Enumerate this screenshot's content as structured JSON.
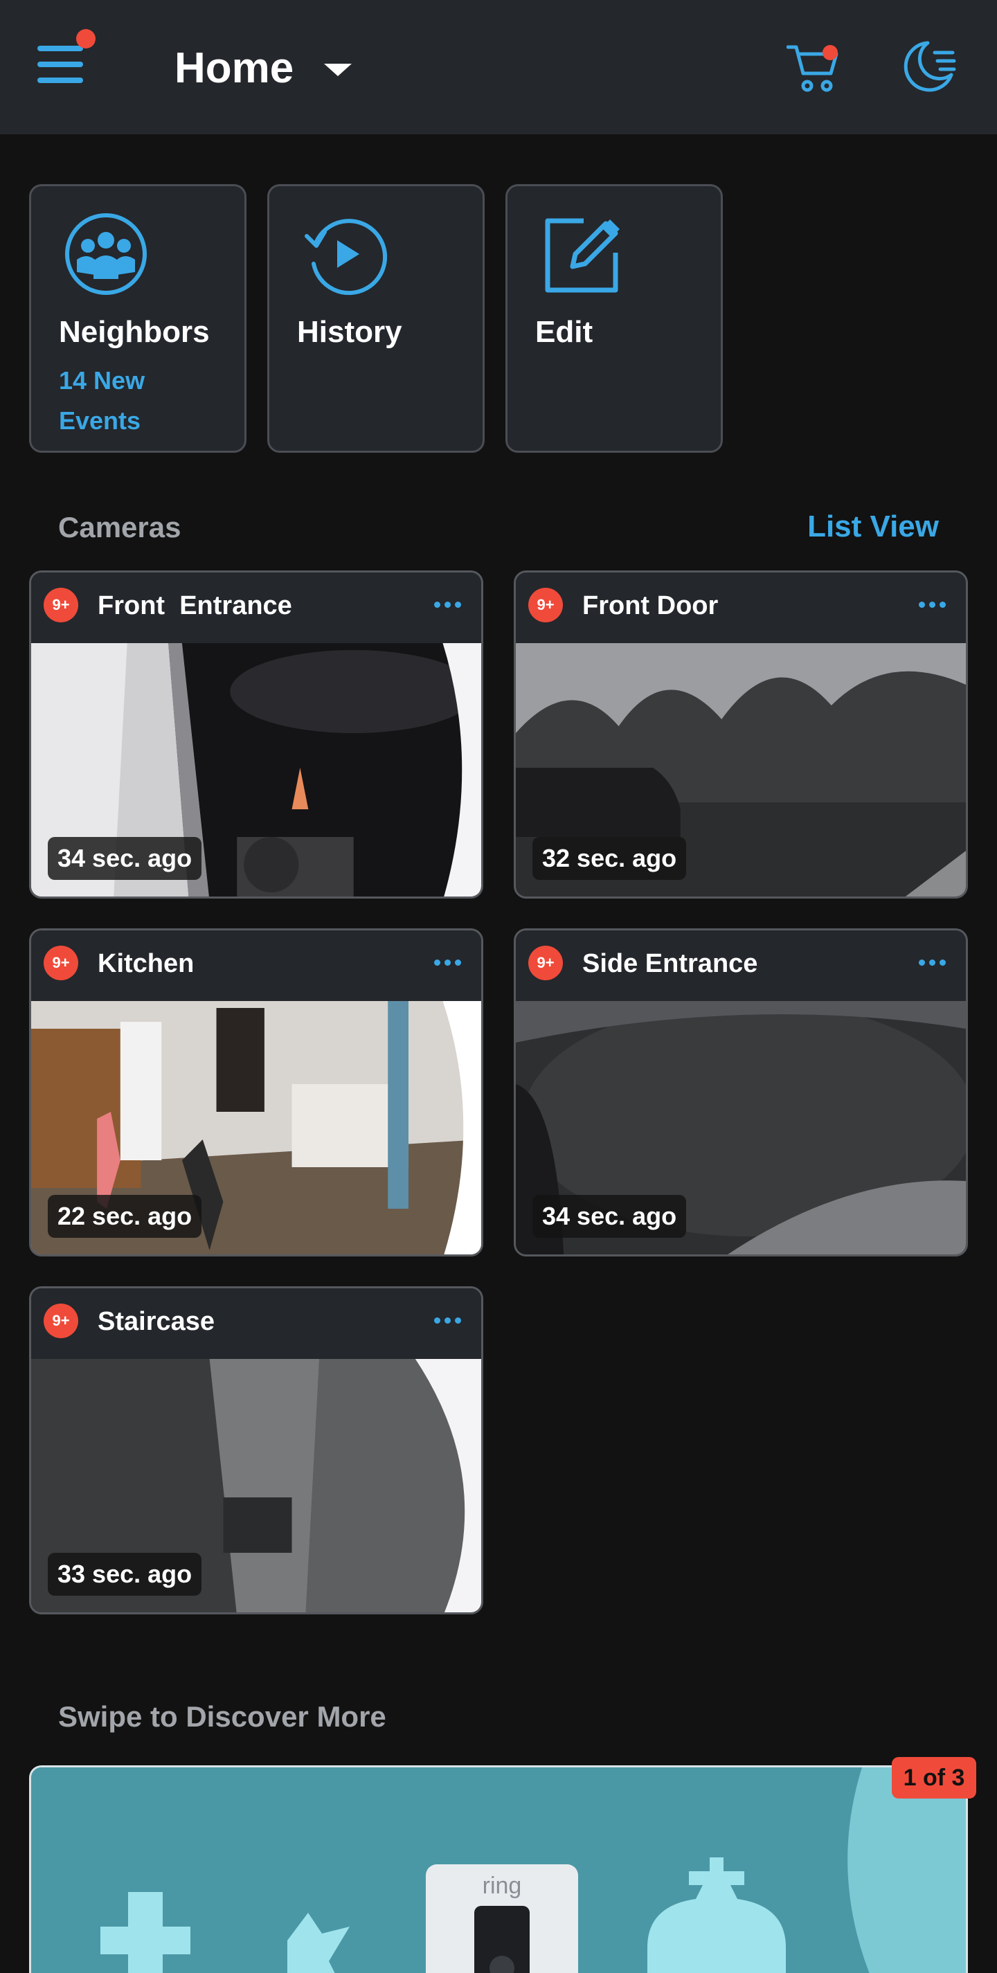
{
  "header": {
    "location": "Home",
    "menu_icon": "hamburger-menu-icon",
    "cart_icon": "cart-icon",
    "mode_icon": "moon-icon",
    "accent_color": "#3aa8e6",
    "alert_color": "#f04b3a"
  },
  "tiles": [
    {
      "label": "Neighbors",
      "sub": "14 New Events",
      "icon": "neighbors-icon"
    },
    {
      "label": "History",
      "sub": "",
      "icon": "history-icon"
    },
    {
      "label": "Edit",
      "sub": "",
      "icon": "edit-icon"
    }
  ],
  "cameras_section": {
    "title": "Cameras",
    "list_view": "List View"
  },
  "cameras": [
    {
      "name": "Front  Entrance",
      "badge": "9+",
      "ago": "34 sec. ago"
    },
    {
      "name": "Front Door",
      "badge": "9+",
      "ago": "32 sec. ago"
    },
    {
      "name": "Kitchen",
      "badge": "9+",
      "ago": "22 sec. ago"
    },
    {
      "name": "Side Entrance",
      "badge": "9+",
      "ago": "34 sec. ago"
    },
    {
      "name": "Staircase",
      "badge": "9+",
      "ago": "33 sec. ago"
    }
  ],
  "discover": {
    "title": "Swipe to Discover More",
    "pager": "1 of 3",
    "logo_text": "ring"
  }
}
